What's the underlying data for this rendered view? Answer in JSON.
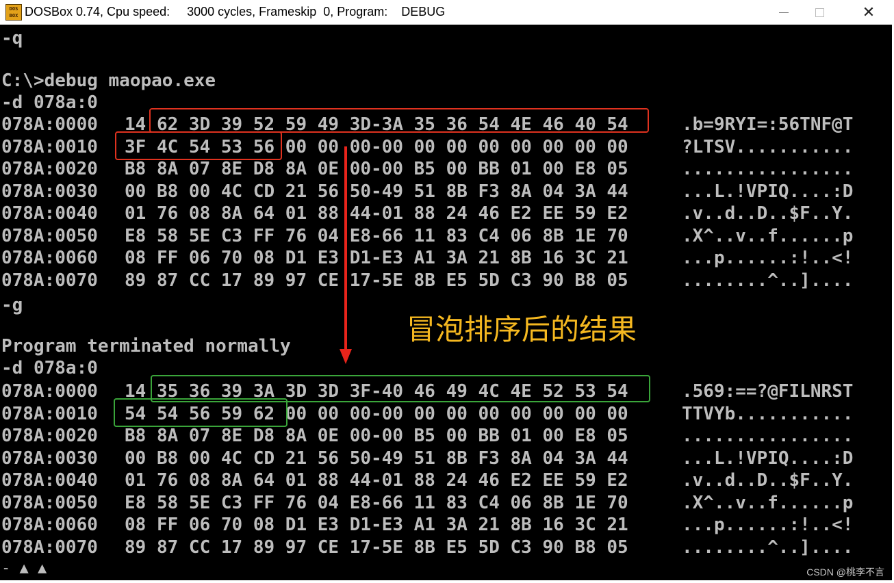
{
  "window": {
    "icon_text": "DOS\nBOX",
    "title": "DOSBox 0.74, Cpu speed:     3000 cycles, Frameskip  0, Program:    DEBUG",
    "controls": {
      "minimize": "",
      "maximize": "",
      "close": "✕"
    }
  },
  "console": {
    "lines": [
      "-q",
      "",
      "C:\\>debug maopao.exe",
      "-d 078a:0"
    ],
    "dump1": [
      {
        "addr": "078A:0000",
        "hex": "14 62 3D 39 52 59 49 3D-3A 35 36 54 4E 46 40 54",
        "ascii": ".b=9RYI=:56TNF@T"
      },
      {
        "addr": "078A:0010",
        "hex": "3F 4C 54 53 56 00 00 00-00 00 00 00 00 00 00 00",
        "ascii": "?LTSV..........."
      },
      {
        "addr": "078A:0020",
        "hex": "B8 8A 07 8E D8 8A 0E 00-00 B5 00 BB 01 00 E8 05",
        "ascii": "................"
      },
      {
        "addr": "078A:0030",
        "hex": "00 B8 00 4C CD 21 56 50-49 51 8B F3 8A 04 3A 44",
        "ascii": "...L.!VPIQ....:D"
      },
      {
        "addr": "078A:0040",
        "hex": "01 76 08 8A 64 01 88 44-01 88 24 46 E2 EE 59 E2",
        "ascii": ".v..d..D..$F..Y."
      },
      {
        "addr": "078A:0050",
        "hex": "E8 58 5E C3 FF 76 04 E8-66 11 83 C4 06 8B 1E 70",
        "ascii": ".X^..v..f......p"
      },
      {
        "addr": "078A:0060",
        "hex": "08 FF 06 70 08 D1 E3 D1-E3 A1 3A 21 8B 16 3C 21",
        "ascii": "...p......:!..<!"
      },
      {
        "addr": "078A:0070",
        "hex": "89 87 CC 17 89 97 CE 17-5E 8B E5 5D C3 90 B8 05",
        "ascii": "........^..]...."
      }
    ],
    "lines2": [
      "-g",
      "",
      "Program terminated normally",
      "-d 078a:0"
    ],
    "dump2": [
      {
        "addr": "078A:0000",
        "hex": "14 35 36 39 3A 3D 3D 3F-40 46 49 4C 4E 52 53 54",
        "ascii": ".569:==?@FILNRST"
      },
      {
        "addr": "078A:0010",
        "hex": "54 54 56 59 62 00 00 00-00 00 00 00 00 00 00 00",
        "ascii": "TTVYb..........."
      },
      {
        "addr": "078A:0020",
        "hex": "B8 8A 07 8E D8 8A 0E 00-00 B5 00 BB 01 00 E8 05",
        "ascii": "................"
      },
      {
        "addr": "078A:0030",
        "hex": "00 B8 00 4C CD 21 56 50-49 51 8B F3 8A 04 3A 44",
        "ascii": "...L.!VPIQ....:D"
      },
      {
        "addr": "078A:0040",
        "hex": "01 76 08 8A 64 01 88 44-01 88 24 46 E2 EE 59 E2",
        "ascii": ".v..d..D..$F..Y."
      },
      {
        "addr": "078A:0050",
        "hex": "E8 58 5E C3 FF 76 04 E8-66 11 83 C4 06 8B 1E 70",
        "ascii": ".X^..v..f......p"
      },
      {
        "addr": "078A:0060",
        "hex": "08 FF 06 70 08 D1 E3 D1-E3 A1 3A 21 8B 16 3C 21",
        "ascii": "...p......:!..<!"
      },
      {
        "addr": "078A:0070",
        "hex": "89 87 CC 17 89 97 CE 17-5E 8B E5 5D C3 90 B8 05",
        "ascii": "........^..]...."
      }
    ],
    "prompt_tail": "- ▲ ▲"
  },
  "annotation": {
    "text": "冒泡排序后的结果",
    "color": "#f5b820"
  },
  "watermark": "CSDN @桃李不言",
  "colors": {
    "console_bg": "#000000",
    "console_fg": "#bdbdbd",
    "highlight_before": "#e0321f",
    "highlight_after": "#3aa53a",
    "arrow": "#e8241b"
  }
}
